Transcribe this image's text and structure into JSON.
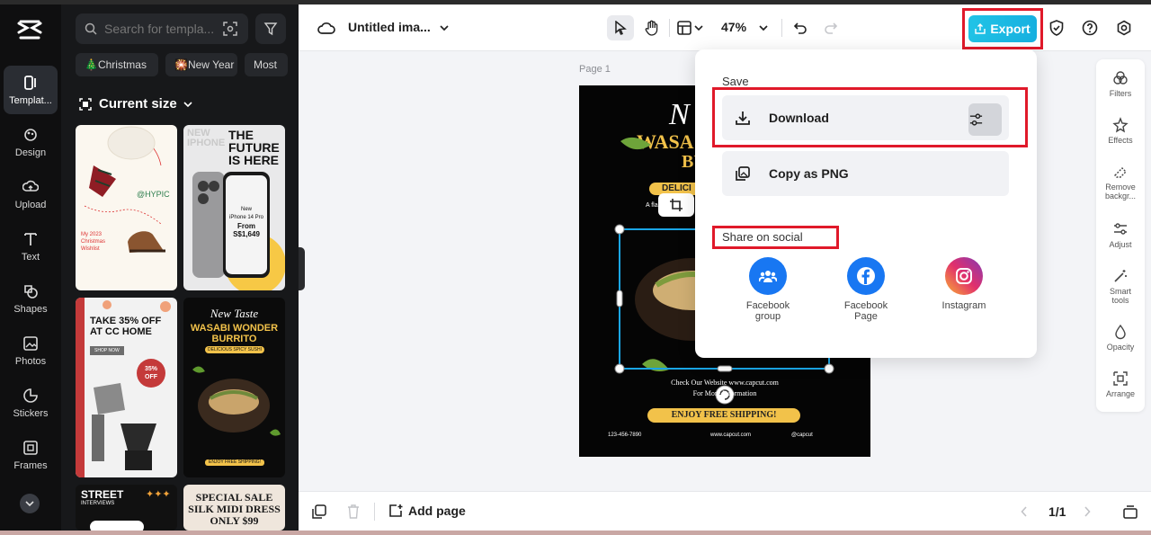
{
  "rail": {
    "items": [
      {
        "label": "Templat..."
      },
      {
        "label": "Design"
      },
      {
        "label": "Upload"
      },
      {
        "label": "Text"
      },
      {
        "label": "Shapes"
      },
      {
        "label": "Photos"
      },
      {
        "label": "Stickers"
      },
      {
        "label": "Frames"
      }
    ]
  },
  "panel": {
    "search_placeholder": "Search for templa...",
    "chips": [
      "🎄Christmas",
      "🎇New Year",
      "Most"
    ],
    "current_size": "Current size",
    "thumbs": [
      {
        "lines": [
          "@HYPIC",
          "My 2023",
          "Christmas",
          "Wishlist"
        ]
      },
      {
        "lines": [
          "NEW",
          "IPHONE",
          "THE",
          "FUTURE",
          "IS HERE",
          "New",
          "iPhone 14 Pro",
          "From",
          "S$1,649"
        ]
      },
      {
        "lines": [
          "TAKE 35% OFF",
          "AT CC HOME",
          "SHOP NOW",
          "35%",
          "OFF"
        ]
      },
      {
        "lines": [
          "New Taste",
          "WASABI WONDER",
          "BURRITO",
          "DELICIOUS SPICY SUSHI",
          "ENJOY FREE SHIPPING!"
        ]
      },
      {
        "lines": [
          "STREET",
          "INTERVIEWS",
          "✦✦✦"
        ]
      },
      {
        "lines": [
          "SPECIAL SALE",
          "SILK MIDI DRESS",
          "ONLY $99"
        ]
      }
    ]
  },
  "toolbar": {
    "title": "Untitled ima...",
    "zoom": "47%",
    "export_label": "Export"
  },
  "canvas": {
    "page_label": "Page 1",
    "artboard": {
      "headline_top": "N",
      "headline": "WASA",
      "headline2": "BU",
      "tag": "DELICI",
      "sub": "A fla",
      "website1": "Check Our Website www.capcut.com",
      "website2": "For More Information",
      "shipping": "ENJOY FREE SHIPPING!",
      "phone": "123-456-7890",
      "site": "www.capcut.com",
      "handle": "@capcut"
    }
  },
  "right_tools": [
    {
      "label": "Filters"
    },
    {
      "label": "Effects"
    },
    {
      "label": "Remove backgr..."
    },
    {
      "label": "Adjust"
    },
    {
      "label": "Smart tools"
    },
    {
      "label": "Opacity"
    },
    {
      "label": "Arrange"
    }
  ],
  "bottombar": {
    "add_page": "Add page",
    "page_count": "1/1"
  },
  "popup": {
    "save_heading": "Save",
    "download": "Download",
    "copy_png": "Copy as PNG",
    "share_heading": "Share on social",
    "socials": [
      {
        "label": "Facebook group",
        "color": "#1877f2"
      },
      {
        "label": "Facebook Page",
        "color": "#1877f2"
      },
      {
        "label": "Instagram",
        "color": "#e1306c"
      }
    ]
  }
}
